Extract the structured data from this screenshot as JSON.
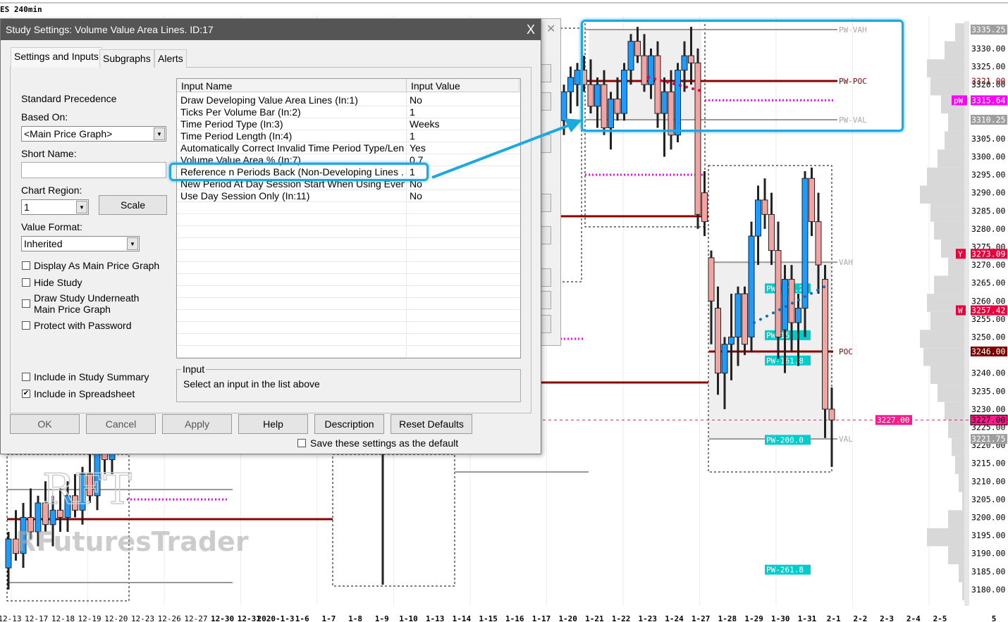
{
  "chart": {
    "title": "ES 240min",
    "price_labels": [
      "3330.00",
      "3325.00",
      "3320.00",
      "3305.00",
      "3300.00",
      "3295.00",
      "3290.00",
      "3285.00",
      "3280.00",
      "3275.00",
      "3270.00",
      "3265.00",
      "3260.00",
      "3255.00",
      "3250.00",
      "3240.00",
      "3235.00",
      "3230.00",
      "3225.00",
      "3220.00",
      "3215.00",
      "3210.00",
      "3205.00",
      "3200.00",
      "3195.00",
      "3190.00",
      "3185.00",
      "3180.00"
    ],
    "price_labels_values": [
      3330,
      3325,
      3320,
      3305,
      3300,
      3295,
      3290,
      3285,
      3280,
      3275,
      3270,
      3265,
      3260,
      3255,
      3250,
      3240,
      3235,
      3230,
      3225,
      3220,
      3215,
      3210,
      3205,
      3200,
      3195,
      3190,
      3185,
      3180
    ],
    "markers": [
      {
        "text": "3335.25",
        "price": 3335.25,
        "bg": "#9e9e9e",
        "fg": "#ffffff"
      },
      {
        "text": "3321.00",
        "price": 3321.0,
        "bg": "transparent",
        "fg": "#8b0000"
      },
      {
        "text": "3315.64",
        "price": 3315.64,
        "bg": "#ff00ff",
        "fg": "#ffffff",
        "tag": "pW"
      },
      {
        "text": "3310.25",
        "price": 3310.25,
        "bg": "#9e9e9e",
        "fg": "#ffffff"
      },
      {
        "text": "3273.09",
        "price": 3273.09,
        "bg": "#e8003c",
        "fg": "#ffffff",
        "tag": "Y"
      },
      {
        "text": "3257.42",
        "price": 3257.42,
        "bg": "#e8003c",
        "fg": "#ffffff",
        "tag": "W"
      },
      {
        "text": "3246.00",
        "price": 3246.0,
        "bg": "#7a0000",
        "fg": "#ffffff"
      },
      {
        "text": "3227.00",
        "price": 3227.0,
        "bg": "#ff1a8c",
        "fg": "#000000"
      },
      {
        "text": "3221.75",
        "price": 3221.75,
        "bg": "#9e9e9e",
        "fg": "#ffffff"
      }
    ],
    "last_price_label": "3227.00",
    "level_labels": {
      "pw_vah": "PW-VAH",
      "pw_poc": "PW-POC",
      "pw_val": "PW-VAL",
      "vah": "VAH",
      "poc": "POC",
      "val": "VAL"
    },
    "levels": {
      "pw_vah": 3335.25,
      "pw_poc": 3321.0,
      "pw_val": 3310.25,
      "vah": 3270.75,
      "poc": 3246.0,
      "val": 3221.75,
      "pw_mid": 3315.64,
      "prev_mid": 3295.0,
      "prev_poc": 3283.5,
      "last": 3227.0
    },
    "fib_labels": [
      {
        "text": "PW-127.2",
        "price": 3263.5
      },
      {
        "text": "PW-15",
        "price": 3250.5
      },
      {
        "text": "PW-161.8",
        "price": 3243.5
      },
      {
        "text": "PW-200.0",
        "price": 3221.5
      },
      {
        "text": "PW-261.8",
        "price": 3185.5
      }
    ],
    "dates": [
      "12-13",
      "12-17",
      "12-18",
      "12-19",
      "12-20",
      "12-23",
      "12-26",
      "12-27",
      "12-30",
      "12-31",
      "2020-1-3",
      "1-6",
      "1-7",
      "1-8",
      "1-9",
      "1-10",
      "1-13",
      "1-14",
      "1-15",
      "1-16",
      "1-17",
      "1-20",
      "1-21",
      "1-22",
      "1-23",
      "1-24",
      "1-27",
      "1-28",
      "1-29",
      "1-30",
      "1-31",
      "2-1",
      "2-2",
      "2-3",
      "2-4",
      "2-5",
      "5"
    ],
    "watermark": [
      "RFT",
      "RFuturesTrader"
    ],
    "candles": [
      [
        3310,
        3320,
        3306,
        3318
      ],
      [
        3318,
        3325,
        3312,
        3322
      ],
      [
        3320,
        3326,
        3314,
        3324
      ],
      [
        3324,
        3328,
        3318,
        3320
      ],
      [
        3320,
        3327,
        3312,
        3314
      ],
      [
        3314,
        3322,
        3308,
        3320
      ],
      [
        3320,
        3324,
        3306,
        3308
      ],
      [
        3308,
        3318,
        3302,
        3316
      ],
      [
        3316,
        3322,
        3310,
        3312
      ],
      [
        3312,
        3326,
        3310,
        3324
      ],
      [
        3324,
        3334,
        3320,
        3332
      ],
      [
        3332,
        3336,
        3326,
        3328
      ],
      [
        3328,
        3334,
        3318,
        3320
      ],
      [
        3320,
        3330,
        3316,
        3328
      ],
      [
        3328,
        3332,
        3308,
        3312
      ],
      [
        3312,
        3322,
        3300,
        3318
      ],
      [
        3318,
        3324,
        3302,
        3306
      ],
      [
        3306,
        3326,
        3304,
        3324
      ],
      [
        3324,
        3332,
        3318,
        3328
      ],
      [
        3328,
        3336,
        3320,
        3326
      ],
      [
        3326,
        3330,
        3280,
        3284
      ],
      [
        3290,
        3296,
        3278,
        3282
      ],
      [
        3272,
        3274,
        3248,
        3260
      ],
      [
        3258,
        3264,
        3234,
        3240
      ],
      [
        3240,
        3250,
        3230,
        3248
      ],
      [
        3248,
        3262,
        3238,
        3250
      ],
      [
        3250,
        3264,
        3242,
        3262
      ],
      [
        3262,
        3264,
        3245,
        3248
      ],
      [
        3250,
        3282,
        3246,
        3278
      ],
      [
        3278,
        3292,
        3270,
        3288
      ],
      [
        3288,
        3294,
        3280,
        3284
      ],
      [
        3284,
        3290,
        3270,
        3274
      ],
      [
        3274,
        3282,
        3244,
        3250
      ],
      [
        3252,
        3270,
        3240,
        3266
      ],
      [
        3266,
        3270,
        3246,
        3254
      ],
      [
        3254,
        3262,
        3242,
        3258
      ],
      [
        3258,
        3296,
        3250,
        3294
      ],
      [
        3294,
        3297,
        3278,
        3282
      ],
      [
        3282,
        3290,
        3262,
        3270
      ],
      [
        3266,
        3270,
        3222,
        3230
      ],
      [
        3230,
        3236,
        3214,
        3227
      ]
    ],
    "left_candles": [
      [
        3186,
        3196,
        3180,
        3194
      ],
      [
        3194,
        3202,
        3188,
        3190
      ],
      [
        3190,
        3204,
        3186,
        3200
      ],
      [
        3200,
        3208,
        3194,
        3196
      ],
      [
        3196,
        3206,
        3192,
        3204
      ],
      [
        3204,
        3210,
        3196,
        3198
      ],
      [
        3198,
        3206,
        3192,
        3202
      ],
      [
        3202,
        3208,
        3196,
        3200
      ],
      [
        3200,
        3210,
        3196,
        3206
      ],
      [
        3206,
        3212,
        3200,
        3202
      ],
      [
        3202,
        3214,
        3198,
        3212
      ],
      [
        3212,
        3218,
        3204,
        3206
      ],
      [
        3206,
        3220,
        3202,
        3218
      ],
      [
        3218,
        3224,
        3212,
        3216
      ],
      [
        3216,
        3226,
        3212,
        3224
      ],
      [
        3224,
        3232,
        3218,
        3230
      ]
    ],
    "volume_profile": [
      20,
      35,
      60,
      55,
      40,
      30,
      35,
      45,
      60,
      70,
      55,
      50,
      40,
      30,
      50,
      60,
      55,
      70,
      65,
      55,
      45,
      35,
      30,
      25,
      20,
      15,
      10,
      30,
      60,
      30,
      15,
      10
    ]
  },
  "dialog": {
    "title": "Study Settings: Volume Value Area Lines. ID:17",
    "close": "X",
    "tabs": [
      "Settings and Inputs",
      "Subgraphs",
      "Alerts"
    ],
    "standard_precedence": "Standard Precedence",
    "based_on_label": "Based On:",
    "based_on_value": "<Main Price Graph>",
    "short_name_label": "Short Name:",
    "short_name_value": "",
    "chart_region_label": "Chart Region:",
    "chart_region_value": "1",
    "scale_button": "Scale",
    "value_format_label": "Value Format:",
    "value_format_value": "Inherited",
    "checkboxes": [
      {
        "label": "Display As Main Price Graph",
        "checked": false
      },
      {
        "label": "Hide Study",
        "checked": false
      },
      {
        "label": "Draw Study Underneath Main Price Graph",
        "checked": false
      },
      {
        "label": "Protect with Password",
        "checked": false
      },
      {
        "label": "Include in Study Summary",
        "checked": false
      },
      {
        "label": "Include in Spreadsheet",
        "checked": true
      }
    ],
    "grid_headers": [
      "Input Name",
      "Input Value"
    ],
    "inputs": [
      {
        "name": "Draw Developing Value Area Lines   (In:1)",
        "value": "No"
      },
      {
        "name": "Ticks Per Volume Bar   (In:2)",
        "value": "1"
      },
      {
        "name": "Time Period Type   (In:3)",
        "value": "Weeks"
      },
      {
        "name": "Time Period Length   (In:4)",
        "value": "1"
      },
      {
        "name": "Automatically Correct Invalid Time Period Type/Len...",
        "value": "Yes"
      },
      {
        "name": "Volume Value Area %   (In:7)",
        "value": "0.7"
      },
      {
        "name": "Reference n Periods Back (Non-Developing Lines ...",
        "value": "1"
      },
      {
        "name": "New Period At Day Session Start When Using Eveni...",
        "value": "No"
      },
      {
        "name": "Use Day Session Only   (In:11)",
        "value": "No"
      }
    ],
    "input_group_label": "Input",
    "input_help": "Select an input in the list above",
    "buttons": [
      "OK",
      "Cancel",
      "Apply",
      "Help",
      "Description",
      "Reset Defaults"
    ],
    "save_default_label": "Save these settings as the default"
  },
  "colors": {
    "up": "#1e9bff",
    "down": "#f4a3a3",
    "poc": "#8b0000",
    "highlight": "#1ea8e0",
    "fib": "#00cccc",
    "magenta": "#ff00ff"
  }
}
